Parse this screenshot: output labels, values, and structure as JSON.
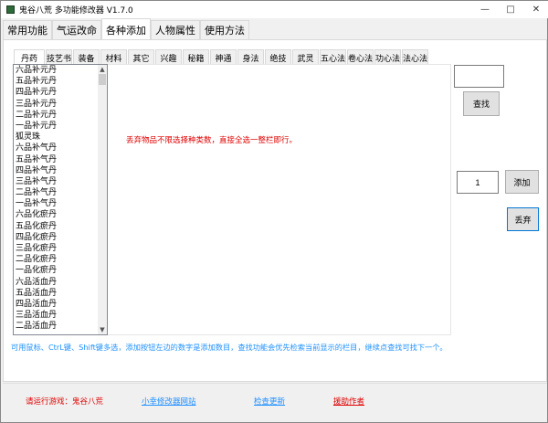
{
  "window": {
    "title": "鬼谷八荒 多功能修改器  V1.7.0",
    "minimize": "—",
    "maximize": "□",
    "close": "✕"
  },
  "main_tabs": [
    "常用功能",
    "气运改命",
    "各种添加",
    "人物属性",
    "使用方法"
  ],
  "active_main_tab": 2,
  "sub_tabs": [
    "丹药",
    "技艺书",
    "装备",
    "材料",
    "其它",
    "兴趣",
    "秘籍",
    "神通",
    "身法",
    "绝技",
    "武灵",
    "五心法",
    "卷心法",
    "功心法",
    "法心法"
  ],
  "active_sub_tab": 0,
  "items": [
    "六品补元丹",
    "五品补元丹",
    "四品补元丹",
    "三品补元丹",
    "二品补元丹",
    "一品补元丹",
    "狐灵珠",
    "六品补气丹",
    "五品补气丹",
    "四品补气丹",
    "三品补气丹",
    "二品补气丹",
    "一品补气丹",
    "六品化瘀丹",
    "五品化瘀丹",
    "四品化瘀丹",
    "三品化瘀丹",
    "二品化瘀丹",
    "一品化瘀丹",
    "六品活血丹",
    "五品活血丹",
    "四品活血丹",
    "三品活血丹",
    "二品活血丹"
  ],
  "discard_tip": "丢弃物品不限选择种类数，直接全选一整栏即行。",
  "search": {
    "value": "",
    "button": "查找"
  },
  "add": {
    "quantity": "1",
    "button": "添加"
  },
  "discard_button": "丢弃",
  "hint": "可用鼠标、CtrL键、Shift键多选，添加按钮左边的数字是添加数目，查找功能会优先检索当前显示的栏目，继续点查找可找下一个。",
  "footer": {
    "status": "请运行游戏：鬼谷八荒",
    "website": "小幸修改器网站",
    "update": "检查更新",
    "donate": "援助作者"
  },
  "colors": {
    "red": "#e00000",
    "link": "#1e90ff"
  }
}
